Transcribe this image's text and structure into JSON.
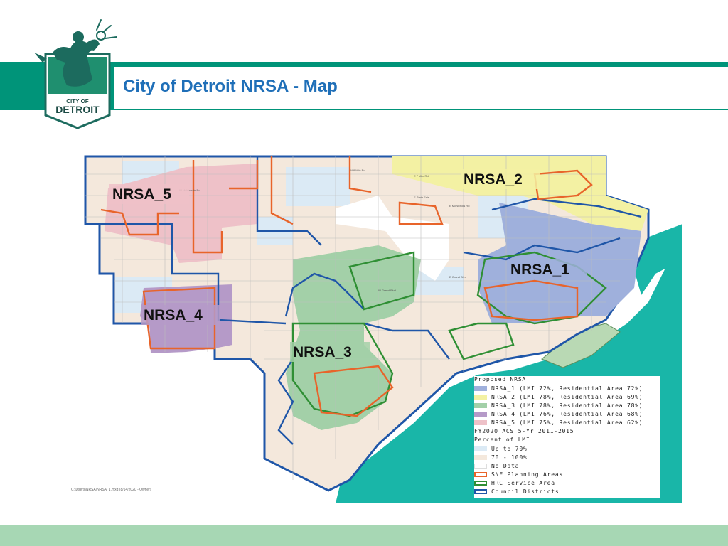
{
  "header": {
    "title": "City of Detroit NRSA - Map",
    "bar_color": "#009479",
    "title_color": "#1f6fb8"
  },
  "logo": {
    "line1": "CITY OF",
    "line2": "DETROIT",
    "icon": "spirit-of-detroit-logo-icon"
  },
  "map": {
    "labels": {
      "nrsa_1": "NRSA_1",
      "nrsa_2": "NRSA_2",
      "nrsa_3": "NRSA_3",
      "nrsa_4": "NRSA_4",
      "nrsa_5": "NRSA_5"
    },
    "file_path": "C:\\Users\\NRSA\\NRSA_1.mxd (8/14/2020 - Owner)",
    "colors": {
      "nrsa_1": "#9fb0dc",
      "nrsa_2": "#f3f1a3",
      "nrsa_3": "#a3d0a8",
      "nrsa_4": "#b59ac8",
      "nrsa_5": "#eec1c8",
      "up_to_70": "#dbeaf5",
      "lmi_70_100": "#f4e8dc",
      "no_data": "#ffffff",
      "snf_planning": "#e8642a",
      "hrc_service": "#2f8f34",
      "council": "#1f56a8",
      "river": "#19b6a8"
    }
  },
  "legend": {
    "title": "Proposed NRSA",
    "nrsa_1": "NRSA_1 (LMI 72%, Residential Area 72%)",
    "nrsa_2": "NRSA_2 (LMI 78%, Residential Area 69%)",
    "nrsa_3": "NRSA_3 (LMI 78%, Residential Area 78%)",
    "nrsa_4": "NRSA_4 (LMI 76%, Residential Area 68%)",
    "nrsa_5": "NRSA_5 (LMI 75%, Residential Area 62%)",
    "source": "FY2020 ACS 5-Yr 2011-2015",
    "pct_title": "Percent of LMI",
    "up_to_70": "Up to 70%",
    "lmi_70_100": "70 - 100%",
    "no_data": "No Data",
    "snf": "SNF Planning Areas",
    "hrc": "HRC Service Area",
    "council": "Council Districts"
  },
  "footer": {
    "color": "#a7d7b4"
  }
}
